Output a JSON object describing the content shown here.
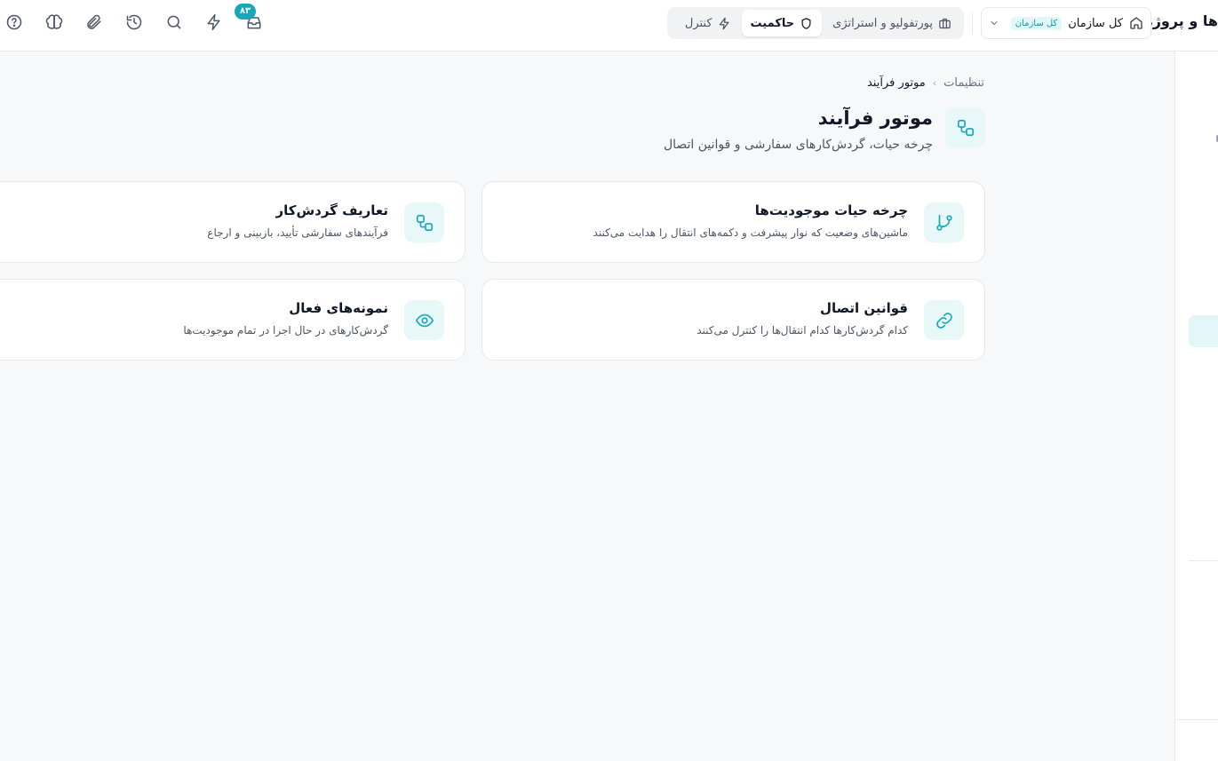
{
  "header": {
    "app_title": "ها و پروژه‌ها",
    "scope": {
      "label": "کل سازمان",
      "badge": "کل سازمان"
    },
    "mode_tabs": [
      {
        "label": "پورتفولیو و استراتژی",
        "icon": "briefcase-icon"
      },
      {
        "label": "حاکمیت",
        "icon": "shield-icon",
        "active": true
      },
      {
        "label": "کنترل",
        "icon": "zap-icon"
      }
    ],
    "inbox_badge": "۸۳",
    "icons": [
      "inbox-icon",
      "zap-icon",
      "search-icon",
      "history-icon",
      "paperclip-icon",
      "brain-icon",
      "help-icon"
    ]
  },
  "breadcrumb": {
    "root": "تنظیمات",
    "separator": "›",
    "current": "موتور فرآیند"
  },
  "page": {
    "title": "موتور فرآیند",
    "subtitle": "چرخه حیات، گردش‌کارهای سفارشی و قوانین اتصال",
    "icon": "workflow-icon"
  },
  "cards": [
    {
      "title": "چرخه حیات موجودیت‌ها",
      "description": "ماشین‌های وضعیت که نوار پیشرفت و دکمه‌های انتقال را هدایت می‌کنند",
      "icon": "git-branch-icon"
    },
    {
      "title": "تعاریف گردش‌کار",
      "description": "فرآیندهای سفارشی تأیید، بازبینی و ارجاع",
      "icon": "workflow-icon"
    },
    {
      "title": "قوانین اتصال",
      "description": "کدام گردش‌کارها کدام انتقال‌ها را کنترل می‌کنند",
      "icon": "link-icon"
    },
    {
      "title": "نمونه‌های فعال",
      "description": "گردش‌کارهای در حال اجرا در تمام موجودیت‌ها",
      "icon": "eye-icon"
    }
  ],
  "colors": {
    "accent": "#14a8b8",
    "accent_soft": "#e8f7f8",
    "border": "#e5e7eb",
    "background": "#f7f8fa"
  }
}
